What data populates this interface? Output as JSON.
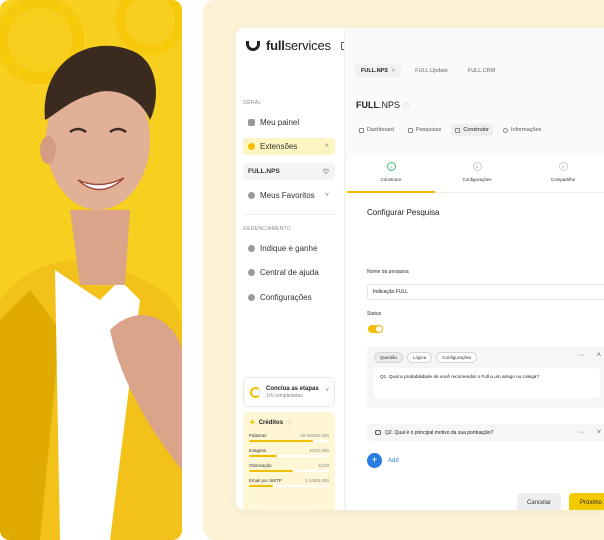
{
  "app": {
    "brand_bold": "full",
    "brand_rest": "services"
  },
  "sidebar": {
    "section_general": "GERAL",
    "items": [
      {
        "label": "Meu painel"
      },
      {
        "label": "Extensões"
      },
      {
        "label": "FULL.NPS"
      },
      {
        "label": "Meus Favoritos"
      }
    ],
    "section_management": "GERENCIAMENTO",
    "items2": [
      {
        "label": "Indique e ganhe"
      },
      {
        "label": "Central de ajuda"
      },
      {
        "label": "Configurações"
      }
    ],
    "steps": {
      "title": "Conclua as etapas",
      "subtitle": "1/4 completadas"
    },
    "credits": {
      "title": "Créditos",
      "rows": [
        {
          "label": "Palavras",
          "value": "40.000/50.000",
          "fraction": 0.8
        },
        {
          "label": "Imagens",
          "value": "100/1.000",
          "fraction": 0.35
        },
        {
          "label": "Otimização",
          "value": "11/20",
          "fraction": 0.55
        },
        {
          "label": "Email por SMTP",
          "value": "1.400/5.000",
          "fraction": 0.3
        }
      ]
    }
  },
  "tabs": [
    {
      "label": "FULL.NPS",
      "active": true
    },
    {
      "label": "FULL.Update"
    },
    {
      "label": "FULL.CRM"
    }
  ],
  "page": {
    "title_bold": "FULL",
    "title_rest": ".NPS",
    "subnav": [
      "Dashboard",
      "Pesquisas",
      "Construtor",
      "Informações"
    ]
  },
  "wizard": {
    "steps": [
      {
        "num": "1",
        "label": "Construtor"
      },
      {
        "num": "2",
        "label": "Configurações"
      },
      {
        "num": "3",
        "label": "Compartilhe"
      }
    ]
  },
  "form": {
    "title": "Configurar Pesquisa",
    "name_label": "Nome da pesquisa",
    "name_value": "Indicação FULL",
    "status_label": "Status",
    "q1": {
      "pills": [
        "Questão",
        "Lógica",
        "Configurações"
      ],
      "text": "Q1. Qual a probabilidade de você recomendar o Full a um amigo ou colega?"
    },
    "q2": {
      "text": "Q2. Qual é o principal motivo da sua pontuação?"
    },
    "add_label": "Add",
    "cancel_label": "Cancelar",
    "next_label": "Próximo"
  }
}
